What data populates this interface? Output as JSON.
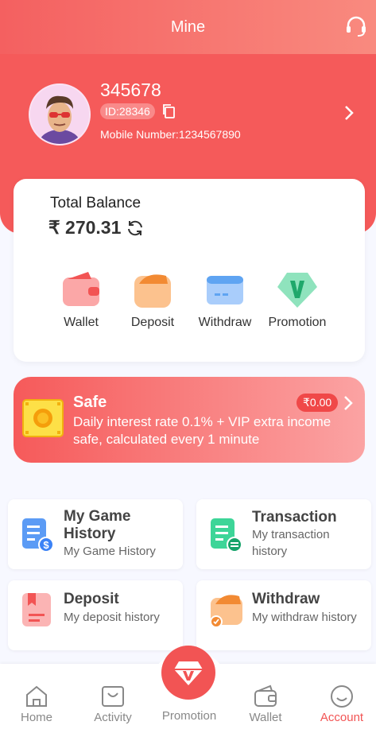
{
  "header": {
    "title": "Mine"
  },
  "user": {
    "name": "345678",
    "id_label": "ID:28346",
    "mobile": "Mobile Number:1234567890"
  },
  "balance": {
    "label": "Total Balance",
    "amount": "₹ 270.31"
  },
  "quick_actions": [
    {
      "label": "Wallet"
    },
    {
      "label": "Deposit"
    },
    {
      "label": "Withdraw"
    },
    {
      "label": "Promotion"
    }
  ],
  "safe": {
    "title": "Safe",
    "badge": "₹0.00",
    "description": "Daily interest rate 0.1% + VIP extra income safe, calculated every 1 minute"
  },
  "history": [
    {
      "title": "My Game History",
      "subtitle": "My Game History"
    },
    {
      "title": "Transaction",
      "subtitle": "My transaction history"
    },
    {
      "title": "Deposit",
      "subtitle": "My deposit history"
    },
    {
      "title": "Withdraw",
      "subtitle": "My withdraw history"
    }
  ],
  "tabbar": {
    "items": [
      {
        "label": "Home"
      },
      {
        "label": "Activity"
      },
      {
        "label": "Promotion"
      },
      {
        "label": "Wallet"
      },
      {
        "label": "Account"
      }
    ],
    "active": "Account"
  },
  "colors": {
    "brand_red": "#f55a5a",
    "active_tab": "#f25454",
    "header_gradient_end": "#f98a7f"
  }
}
